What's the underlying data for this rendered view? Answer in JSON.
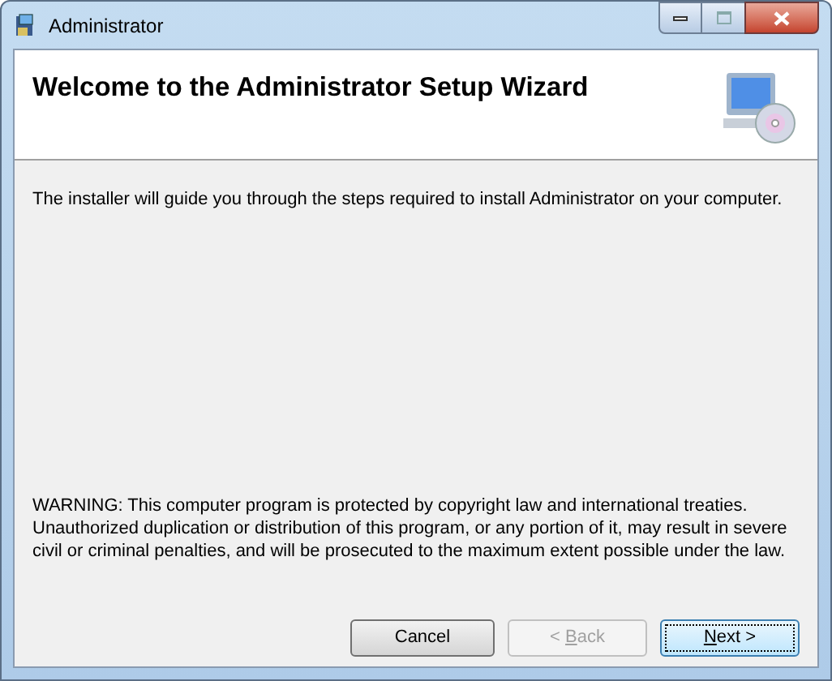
{
  "window": {
    "title": "Administrator"
  },
  "header": {
    "title": "Welcome to the Administrator Setup Wizard"
  },
  "body": {
    "intro": "The installer will guide you through the steps required to install Administrator on your computer.",
    "warning": "WARNING: This computer program is protected by copyright law and international treaties. Unauthorized duplication or distribution of this program, or any portion of it, may result in severe civil or criminal penalties, and will be prosecuted to the maximum extent possible under the law."
  },
  "buttons": [
    {
      "after": "Cancel",
      "disabled": false,
      "default": false
    },
    {
      "before": "< ",
      "mnemonic": "B",
      "after": "ack",
      "disabled": true,
      "default": false
    },
    {
      "mnemonic": "N",
      "after": "ext >",
      "disabled": false,
      "default": true
    }
  ]
}
